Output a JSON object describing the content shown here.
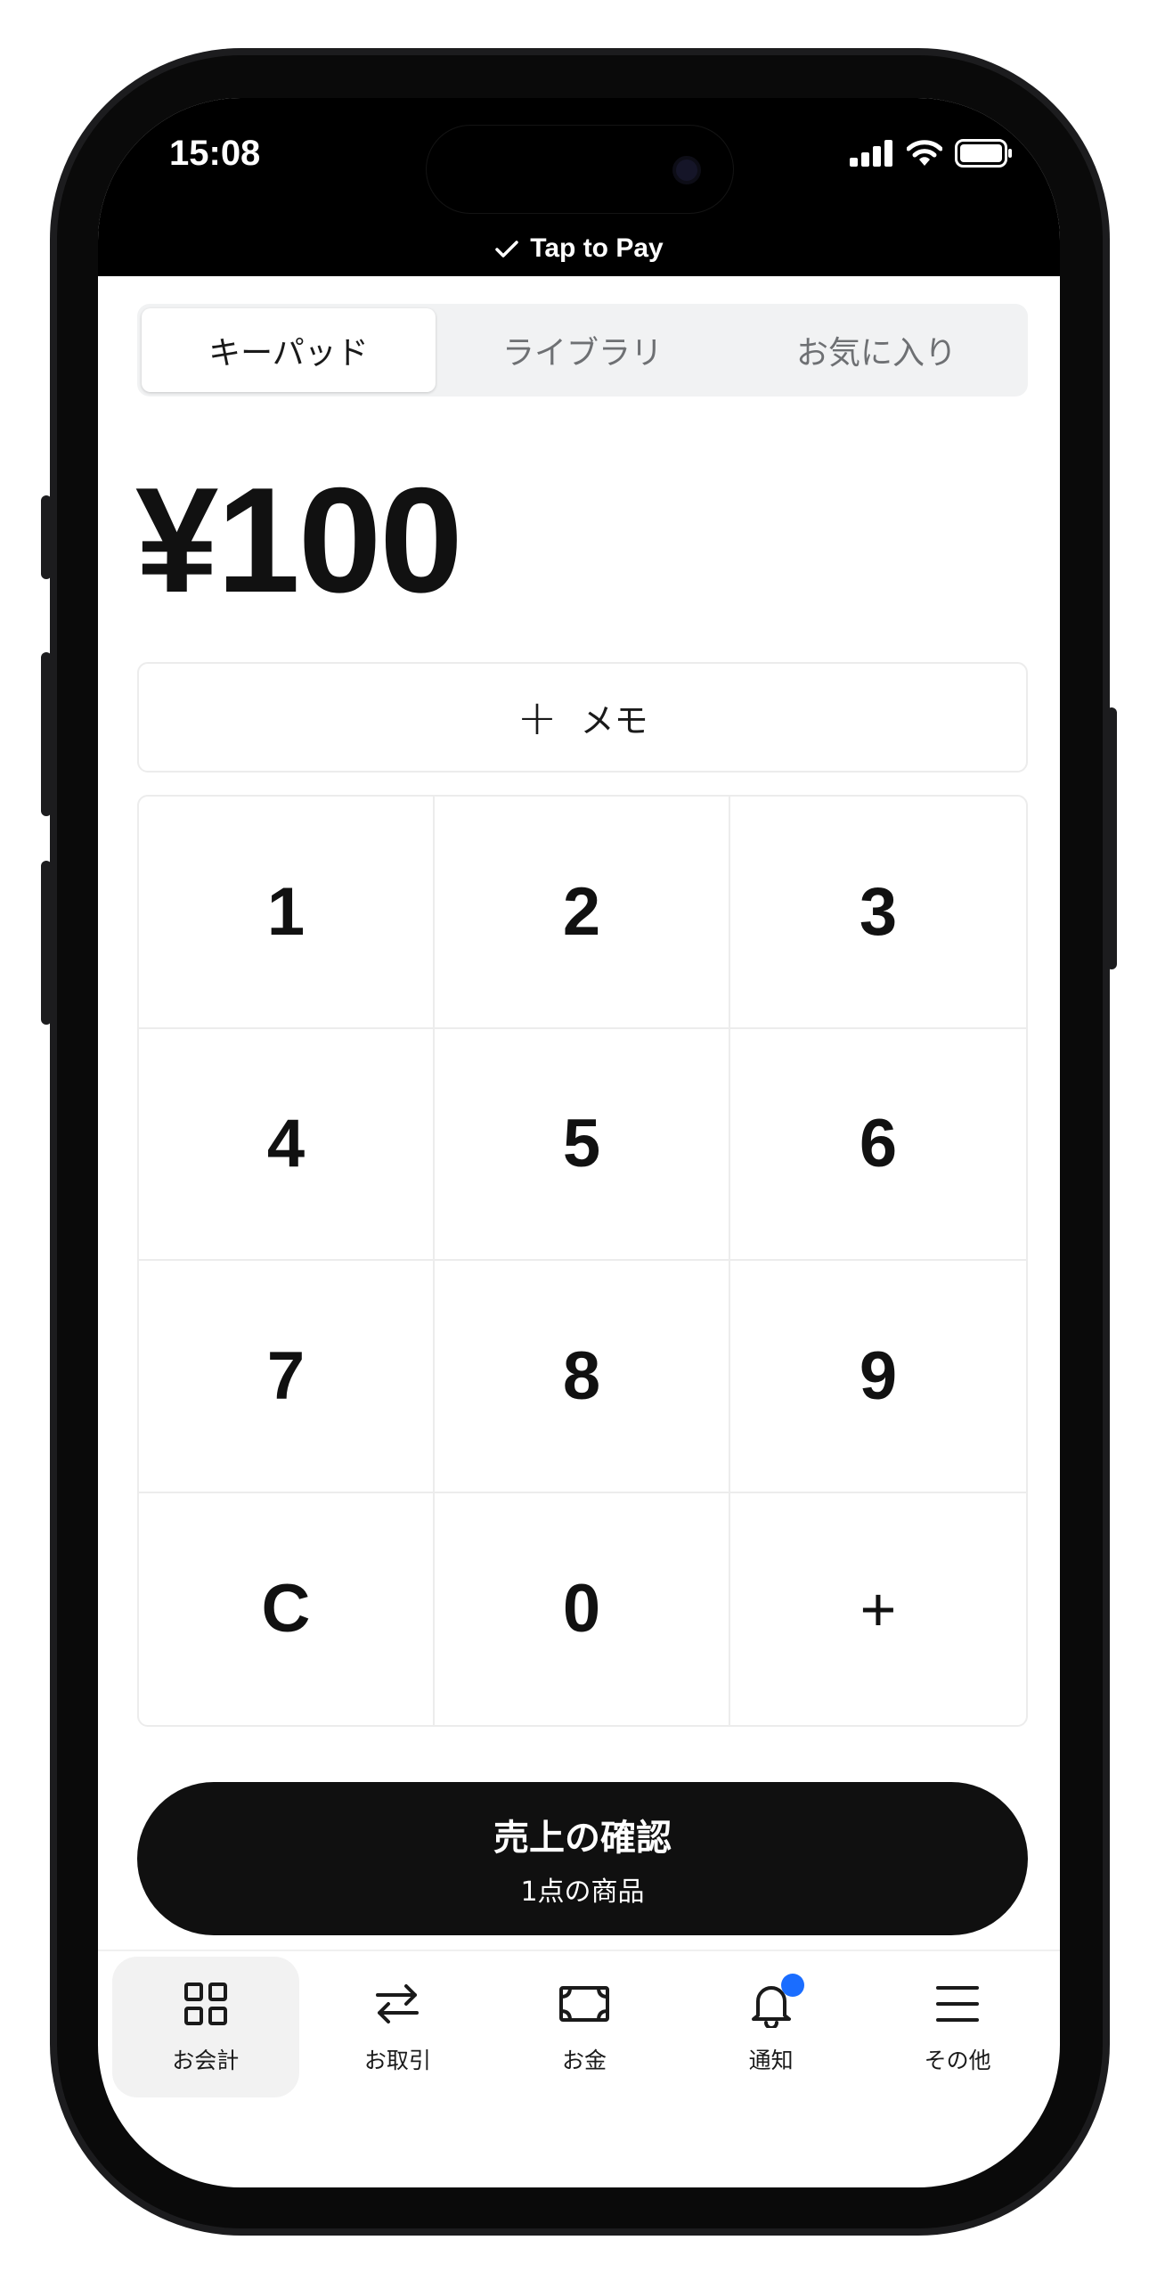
{
  "status_bar": {
    "time": "15:08"
  },
  "banner": {
    "text": "Tap to Pay"
  },
  "tabs": [
    {
      "label": "キーパッド",
      "active": true
    },
    {
      "label": "ライブラリ",
      "active": false
    },
    {
      "label": "お気に入り",
      "active": false
    }
  ],
  "amount": "¥100",
  "memo": {
    "plus": "+",
    "label": "メモ"
  },
  "keypad": [
    "1",
    "2",
    "3",
    "4",
    "5",
    "6",
    "7",
    "8",
    "9",
    "C",
    "0",
    "+"
  ],
  "confirm": {
    "title": "売上の確認",
    "subtitle": "1点の商品"
  },
  "bottom_nav": [
    {
      "label": "お会計",
      "icon": "grid-icon",
      "active": true
    },
    {
      "label": "お取引",
      "icon": "transfer-arrows-icon",
      "active": false
    },
    {
      "label": "お金",
      "icon": "banknote-icon",
      "active": false
    },
    {
      "label": "通知",
      "icon": "bell-icon",
      "active": false,
      "badge": true
    },
    {
      "label": "その他",
      "icon": "menu-icon",
      "active": false
    }
  ],
  "colors": {
    "badge": "#1a6dff",
    "primary_button": "#101010",
    "segmented_bg": "#f1f2f3"
  }
}
